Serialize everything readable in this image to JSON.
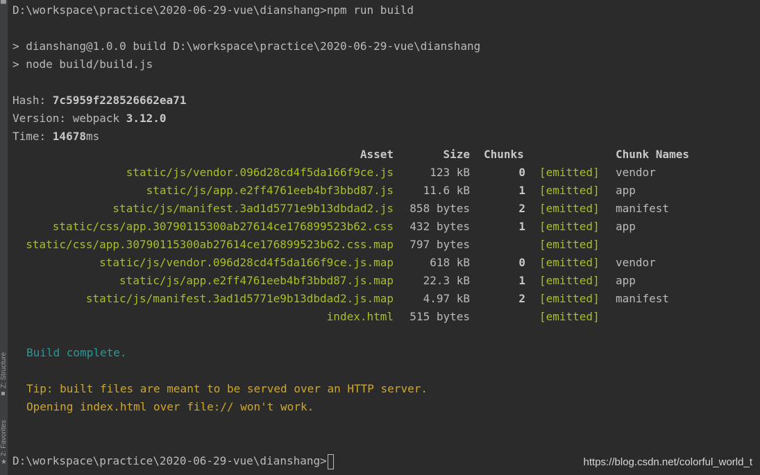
{
  "sidebar": {
    "structure_label": "Z: Structure",
    "favorites_label": "2: Favorites",
    "structure_glyph": "▪",
    "favorites_glyph": "★"
  },
  "terminal": {
    "prompt_line": "D:\\workspace\\practice\\2020-06-29-vue\\dianshang>npm run build",
    "script_line1": "> dianshang@1.0.0 build D:\\workspace\\practice\\2020-06-29-vue\\dianshang",
    "script_line2": "> node build/build.js",
    "hash_label": "Hash: ",
    "hash_value": "7c5959f228526662ea71",
    "version_label": "Version: webpack ",
    "version_value": "3.12.0",
    "time_label": "Time: ",
    "time_value": "14678",
    "time_unit": "ms",
    "table_headers": {
      "asset": "Asset",
      "size": "Size",
      "chunks": "Chunks",
      "chunk_names": "Chunk Names"
    },
    "assets": [
      {
        "name": "static/js/vendor.096d28cd4f5da166f9ce.js",
        "size": "123 kB",
        "chunk": "0",
        "status": "[emitted]",
        "chunk_name": "vendor"
      },
      {
        "name": "static/js/app.e2ff4761eeb4bf3bbd87.js",
        "size": "11.6 kB",
        "chunk": "1",
        "status": "[emitted]",
        "chunk_name": "app"
      },
      {
        "name": "static/js/manifest.3ad1d5771e9b13dbdad2.js",
        "size": "858 bytes",
        "chunk": "2",
        "status": "[emitted]",
        "chunk_name": "manifest"
      },
      {
        "name": "static/css/app.30790115300ab27614ce176899523b62.css",
        "size": "432 bytes",
        "chunk": "1",
        "status": "[emitted]",
        "chunk_name": "app"
      },
      {
        "name": "static/css/app.30790115300ab27614ce176899523b62.css.map",
        "size": "797 bytes",
        "chunk": "",
        "status": "[emitted]",
        "chunk_name": ""
      },
      {
        "name": "static/js/vendor.096d28cd4f5da166f9ce.js.map",
        "size": "618 kB",
        "chunk": "0",
        "status": "[emitted]",
        "chunk_name": "vendor"
      },
      {
        "name": "static/js/app.e2ff4761eeb4bf3bbd87.js.map",
        "size": "22.3 kB",
        "chunk": "1",
        "status": "[emitted]",
        "chunk_name": "app"
      },
      {
        "name": "static/js/manifest.3ad1d5771e9b13dbdad2.js.map",
        "size": "4.97 kB",
        "chunk": "2",
        "status": "[emitted]",
        "chunk_name": "manifest"
      },
      {
        "name": "index.html",
        "size": "515 bytes",
        "chunk": "",
        "status": "[emitted]",
        "chunk_name": ""
      }
    ],
    "build_complete": "Build complete.",
    "tip_line1": "Tip: built files are meant to be served over an HTTP server.",
    "tip_line2": "Opening index.html over file:// won't work.",
    "final_prompt": "D:\\workspace\\practice\\2020-06-29-vue\\dianshang>"
  },
  "watermark": "https://blog.csdn.net/colorful_world_t",
  "colors": {
    "background": "#2b2b2b",
    "text": "#bbbbbb",
    "asset_green": "#a8c023",
    "success_cyan": "#299999",
    "tip_yellow": "#d0a824"
  }
}
